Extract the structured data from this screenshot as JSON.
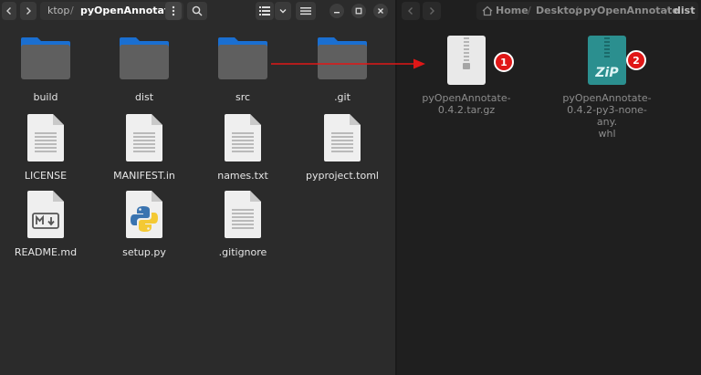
{
  "left_window": {
    "breadcrumb": {
      "partial": "ktop",
      "separator": "/",
      "current": "pyOpenAnnotate"
    },
    "items": [
      {
        "label": "build",
        "icon": "folder-icon"
      },
      {
        "label": "dist",
        "icon": "folder-icon"
      },
      {
        "label": "src",
        "icon": "folder-icon"
      },
      {
        "label": ".git",
        "icon": "folder-icon"
      },
      {
        "label": "LICENSE",
        "icon": "text-file-icon"
      },
      {
        "label": "MANIFEST.in",
        "icon": "text-file-icon"
      },
      {
        "label": "names.txt",
        "icon": "text-file-icon"
      },
      {
        "label": "pyproject.toml",
        "icon": "text-file-icon"
      },
      {
        "label": "README.md",
        "icon": "markdown-file-icon"
      },
      {
        "label": "setup.py",
        "icon": "python-file-icon"
      },
      {
        "label": ".gitignore",
        "icon": "text-file-icon"
      }
    ]
  },
  "right_window": {
    "breadcrumb": [
      "Home",
      "Desktop",
      "pyOpenAnnotate",
      "dist"
    ],
    "separator": "/",
    "items": [
      {
        "label_line1": "pyOpenAnnotate-",
        "label_line2": "0.4.2.tar.gz",
        "label_line3": "",
        "icon": "archive-file-icon",
        "badge": "1"
      },
      {
        "label_line1": "pyOpenAnnotate-",
        "label_line2": "0.4.2-py3-none-any.",
        "label_line3": "whl",
        "icon": "zip-file-icon",
        "badge": "2"
      }
    ],
    "zip_text": "ZiP"
  },
  "colors": {
    "annotation": "#e01717",
    "folder_top": "#1a6fd1",
    "folder_body": "#5f5f5f",
    "zip_teal": "#2b8f8f"
  }
}
